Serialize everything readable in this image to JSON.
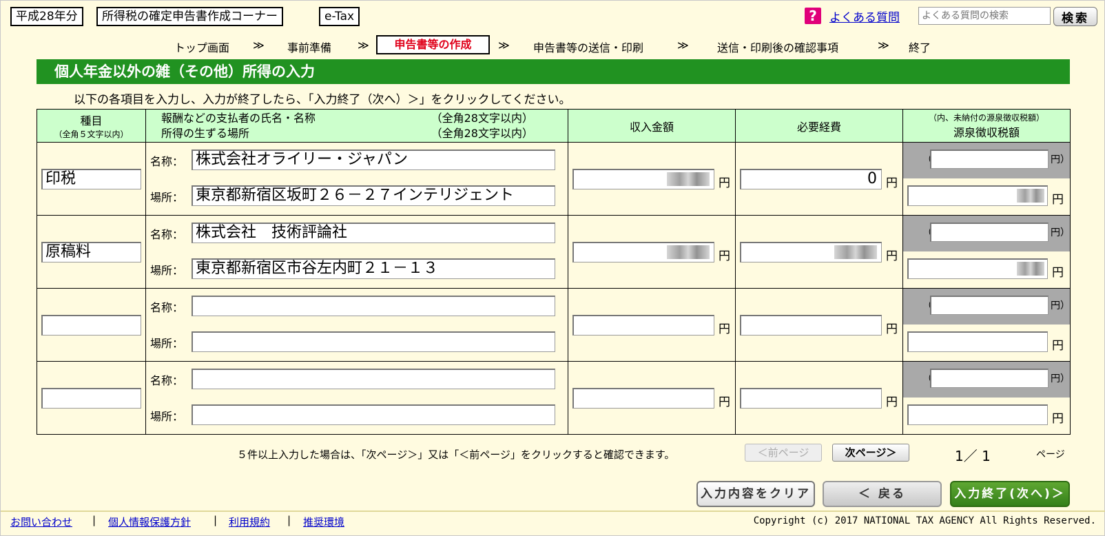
{
  "header": {
    "year": "平成28年分",
    "corner": "所得税の確定申告書作成コーナー",
    "etax": "e-Tax",
    "faq_icon": "?",
    "faq_link": "よくある質問",
    "faq_search_placeholder": "よくある質問の検索",
    "search_button": "検索"
  },
  "steps": [
    "トップ画面",
    "事前準備",
    "申告書等の作成",
    "申告書等の送信・印刷",
    "送信・印刷後の確認事項",
    "終了"
  ],
  "step_sep": "≫",
  "title": "個人年金以外の雑（その他）所得の入力",
  "instruction": "以下の各項目を入力し、入力が終了したら、「入力終了（次へ）＞」をクリックしてください。",
  "table_headers": {
    "kind": "種目",
    "kind_note": "（全角５文字以内）",
    "payer_name": "報酬などの支払者の氏名・名称",
    "payer_name_note": "（全角28文字以内）",
    "place": "所得の生ずる場所",
    "place_note": "（全角28文字以内）",
    "income": "収入金額",
    "expenses": "必要経費",
    "withholding_note": "（内、未納付の源泉徴収税額）",
    "withholding": "源泉徴収税額"
  },
  "labels": {
    "name": "名称：",
    "place": "場所：",
    "yen": "円",
    "paren_open": "（",
    "paren_close": "）"
  },
  "rows": [
    {
      "kind": "印税",
      "name": "株式会社オライリー・ジャパン",
      "place": "東京都新宿区坂町２６－２７インテリジェント",
      "expenses": "0"
    },
    {
      "kind": "原稿料",
      "name": "株式会社　技術評論社",
      "place": "東京都新宿区市谷左内町２１－１３",
      "expenses": ""
    },
    {
      "kind": "",
      "name": "",
      "place": "",
      "expenses": ""
    },
    {
      "kind": "",
      "name": "",
      "place": "",
      "expenses": ""
    }
  ],
  "pagination": {
    "note": "５件以上入力した場合は、「次ページ＞」又は「＜前ページ」をクリックすると確認できます。",
    "prev": "＜前ページ",
    "next": "次ページ＞",
    "current": "1／ 1",
    "unit": "ページ"
  },
  "actions": {
    "clear": "入力内容をクリア",
    "back": "＜ 戻る",
    "next": "入力終了(次へ)＞"
  },
  "footer": {
    "links": [
      "お問い合わせ",
      "個人情報保護方針",
      "利用規約",
      "推奨環境"
    ],
    "copyright": "Copyright (c) 2017 NATIONAL TAX AGENCY All Rights Reserved."
  },
  "colors": {
    "title_green": "#219221",
    "header_green": "#ccffcc",
    "active_step": "#e0001a",
    "background": "#fffbe0"
  }
}
